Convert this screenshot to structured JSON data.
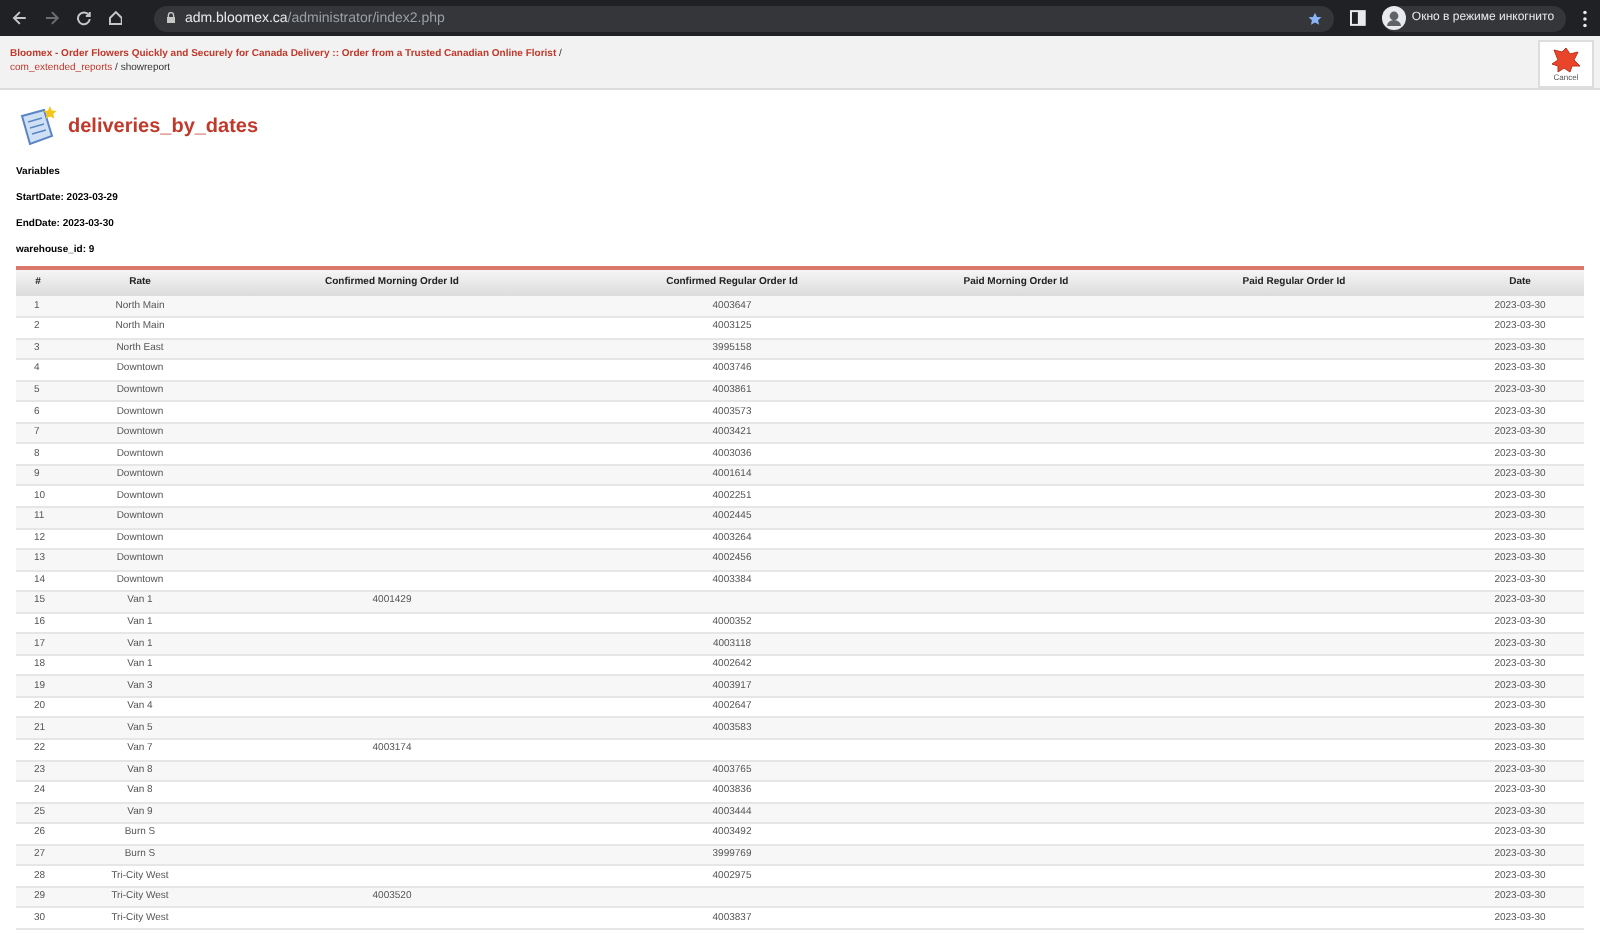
{
  "browser": {
    "url_host": "adm.bloomex.ca",
    "url_path": "/administrator/index2.php",
    "profile_label": "Окно в режиме инкогнито"
  },
  "breadcrumb": {
    "site_link": "Bloomex - Order Flowers Quickly and Securely for Canada Delivery :: Order from a Trusted Canadian Online Florist",
    "separator_1": "/",
    "component_link": "com_extended_reports",
    "separator_2": "/",
    "current": "showreport"
  },
  "toolbar": {
    "cancel_label": "Cancel"
  },
  "report": {
    "title": "deliveries_by_dates",
    "variables_heading": "Variables",
    "variables": [
      "StartDate: 2023-03-29",
      "EndDate: 2023-03-30",
      "warehouse_id: 9"
    ]
  },
  "table": {
    "columns": [
      "#",
      "Rate",
      "Confirmed Morning Order Id",
      "Confirmed Regular Order Id",
      "Paid Morning Order Id",
      "Paid Regular Order Id",
      "Date"
    ],
    "rows": [
      [
        "1",
        "North Main",
        "",
        "4003647",
        "",
        "",
        "2023-03-30"
      ],
      [
        "2",
        "North Main",
        "",
        "4003125",
        "",
        "",
        "2023-03-30"
      ],
      [
        "3",
        "North East",
        "",
        "3995158",
        "",
        "",
        "2023-03-30"
      ],
      [
        "4",
        "Downtown",
        "",
        "4003746",
        "",
        "",
        "2023-03-30"
      ],
      [
        "5",
        "Downtown",
        "",
        "4003861",
        "",
        "",
        "2023-03-30"
      ],
      [
        "6",
        "Downtown",
        "",
        "4003573",
        "",
        "",
        "2023-03-30"
      ],
      [
        "7",
        "Downtown",
        "",
        "4003421",
        "",
        "",
        "2023-03-30"
      ],
      [
        "8",
        "Downtown",
        "",
        "4003036",
        "",
        "",
        "2023-03-30"
      ],
      [
        "9",
        "Downtown",
        "",
        "4001614",
        "",
        "",
        "2023-03-30"
      ],
      [
        "10",
        "Downtown",
        "",
        "4002251",
        "",
        "",
        "2023-03-30"
      ],
      [
        "11",
        "Downtown",
        "",
        "4002445",
        "",
        "",
        "2023-03-30"
      ],
      [
        "12",
        "Downtown",
        "",
        "4003264",
        "",
        "",
        "2023-03-30"
      ],
      [
        "13",
        "Downtown",
        "",
        "4002456",
        "",
        "",
        "2023-03-30"
      ],
      [
        "14",
        "Downtown",
        "",
        "4003384",
        "",
        "",
        "2023-03-30"
      ],
      [
        "15",
        "Van 1",
        "4001429",
        "",
        "",
        "",
        "2023-03-30"
      ],
      [
        "16",
        "Van 1",
        "",
        "4000352",
        "",
        "",
        "2023-03-30"
      ],
      [
        "17",
        "Van 1",
        "",
        "4003118",
        "",
        "",
        "2023-03-30"
      ],
      [
        "18",
        "Van 1",
        "",
        "4002642",
        "",
        "",
        "2023-03-30"
      ],
      [
        "19",
        "Van 3",
        "",
        "4003917",
        "",
        "",
        "2023-03-30"
      ],
      [
        "20",
        "Van 4",
        "",
        "4002647",
        "",
        "",
        "2023-03-30"
      ],
      [
        "21",
        "Van 5",
        "",
        "4003583",
        "",
        "",
        "2023-03-30"
      ],
      [
        "22",
        "Van 7",
        "4003174",
        "",
        "",
        "",
        "2023-03-30"
      ],
      [
        "23",
        "Van 8",
        "",
        "4003765",
        "",
        "",
        "2023-03-30"
      ],
      [
        "24",
        "Van 8",
        "",
        "4003836",
        "",
        "",
        "2023-03-30"
      ],
      [
        "25",
        "Van 9",
        "",
        "4003444",
        "",
        "",
        "2023-03-30"
      ],
      [
        "26",
        "Burn S",
        "",
        "4003492",
        "",
        "",
        "2023-03-30"
      ],
      [
        "27",
        "Burn S",
        "",
        "3999769",
        "",
        "",
        "2023-03-30"
      ],
      [
        "28",
        "Tri-City West",
        "",
        "4002975",
        "",
        "",
        "2023-03-30"
      ],
      [
        "29",
        "Tri-City West",
        "4003520",
        "",
        "",
        "",
        "2023-03-30"
      ],
      [
        "30",
        "Tri-City West",
        "",
        "4003837",
        "",
        "",
        "2023-03-30"
      ]
    ]
  }
}
